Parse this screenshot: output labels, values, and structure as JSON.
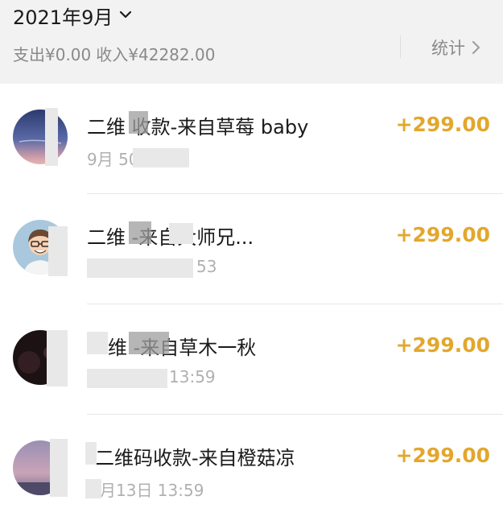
{
  "header": {
    "month": "2021年9月",
    "summary": {
      "expense": "支出¥0.00",
      "income": "收入¥42282.00"
    },
    "stats_label": "统计"
  },
  "transactions": [
    {
      "title": "二维 收款-来自草莓 baby",
      "time": "9月 50",
      "amount": "+299.00",
      "avatar": "avatar-sunset-sky"
    },
    {
      "title": "二维 -来自大师兄...",
      "time": "53",
      "amount": "+299.00",
      "avatar": "avatar-cartoon-boy"
    },
    {
      "title": "维 -来自草木一秋",
      "time": "13:59",
      "amount": "+299.00",
      "avatar": "avatar-dark-night"
    },
    {
      "title": "二维码收款-来自橙菇凉",
      "time": "月13日 13:59",
      "amount": "+299.00",
      "avatar": "avatar-purple-sky"
    }
  ],
  "colors": {
    "amount": "#e3a72c",
    "header_bg": "#f2f2f2",
    "muted_text": "#8a8a8a"
  }
}
